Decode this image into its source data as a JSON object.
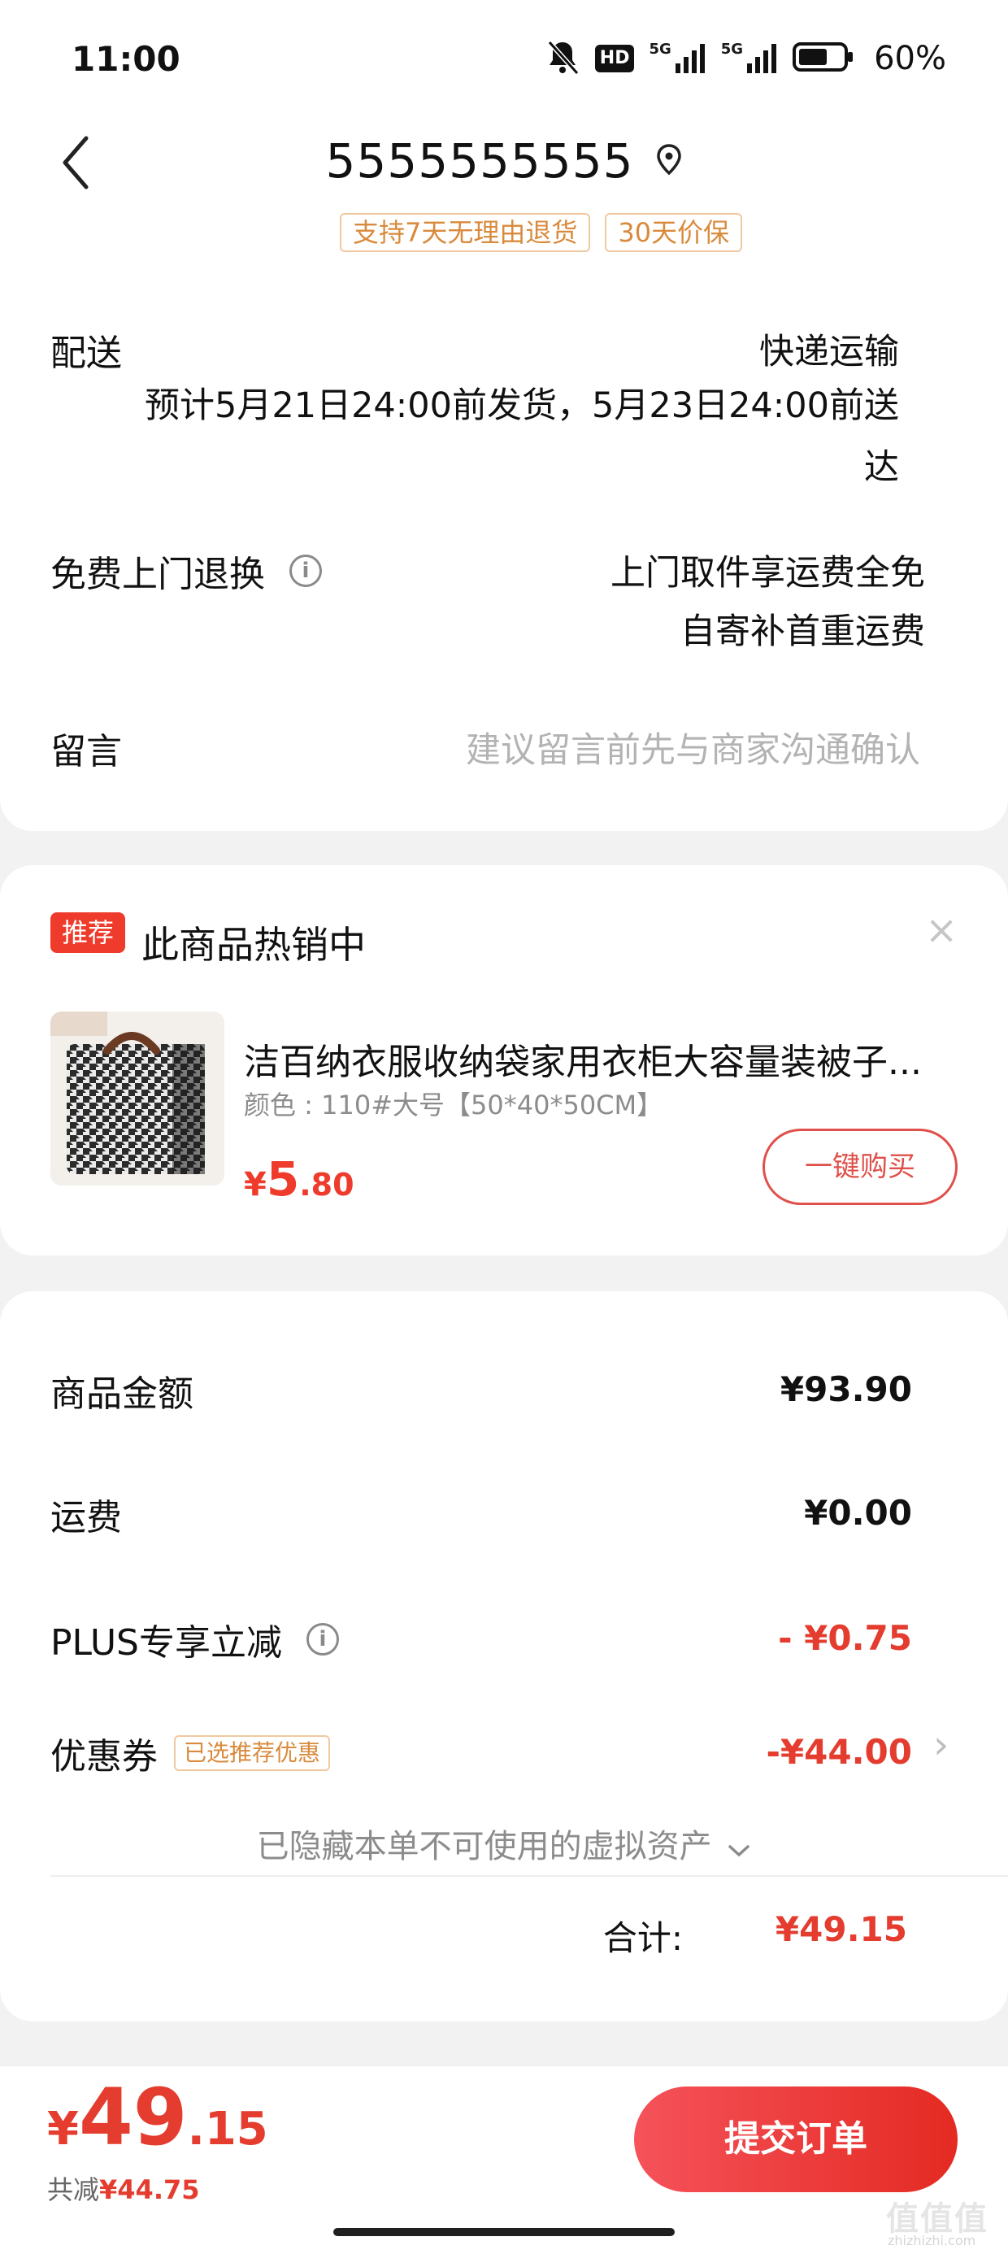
{
  "status_bar": {
    "time": "11:00",
    "hd_label": "HD",
    "net1": "5G",
    "net2": "5G",
    "battery_pct": "60%"
  },
  "header": {
    "title": "5555555555"
  },
  "delivery": {
    "tags": [
      "支持7天无理由退货",
      "30天价保"
    ],
    "label": "配送",
    "method": "快递运输",
    "estimate_line1": "预计5月21日24:00前发货，5月23日24:00前送",
    "estimate_line2": "达"
  },
  "return_service": {
    "label": "免费上门退换",
    "line1": "上门取件享运费全免",
    "line2": "自寄补首重运费"
  },
  "message": {
    "label": "留言",
    "placeholder": "建议留言前先与商家沟通确认"
  },
  "recommend": {
    "badge": "推荐",
    "title": "此商品热销中",
    "close": "×",
    "product_name": "洁百纳衣服收纳袋家用衣柜大容量装被子...",
    "spec": "颜色 : 110#大号【50*40*50CM】",
    "price_symbol": "¥",
    "price_int": "5",
    "price_dec": ".80",
    "buy_button": "一键购买"
  },
  "amounts": {
    "goods_label": "商品金额",
    "goods_value": "¥93.90",
    "freight_label": "运费",
    "freight_value": "¥0.00",
    "plus_label": "PLUS专享立减",
    "plus_value": "- ¥0.75",
    "coupon_label": "优惠券",
    "coupon_tag": "已选推荐优惠",
    "coupon_value": "-¥44.00",
    "coupon_arrow": "›",
    "hidden_note": "已隐藏本单不可使用的虚拟资产",
    "total_label": "合计:",
    "total_value": "¥49.15"
  },
  "bottom": {
    "price_symbol": "¥",
    "price_int": "49",
    "price_dec": ".15",
    "saved_label": "共减",
    "saved_value": "¥44.75",
    "submit": "提交订单"
  },
  "watermark": {
    "main": "值值值",
    "sub": "zhizhizhi.com"
  }
}
